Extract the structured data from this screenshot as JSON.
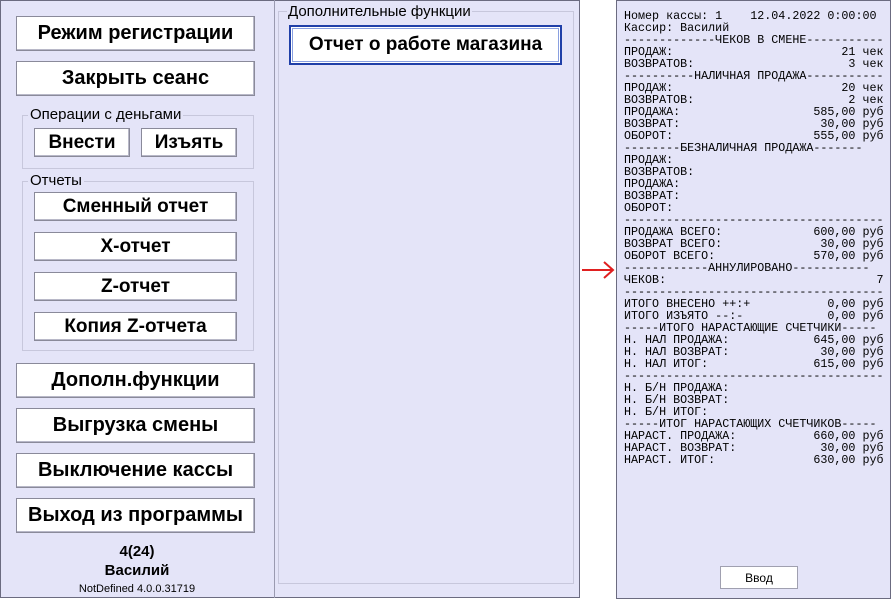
{
  "left_menu": {
    "registration_mode": "Режим регистрации",
    "close_session": "Закрыть сеанс",
    "money_ops_title": "Операции с деньгами",
    "deposit": "Внести",
    "withdraw": "Изъять",
    "reports_title": "Отчеты",
    "shift_report": "Сменный отчет",
    "x_report": "X-отчет",
    "z_report": "Z-отчет",
    "z_copy": "Копия Z-отчета",
    "extra_functions": "Дополн.функции",
    "export_shift": "Выгрузка смены",
    "power_off": "Выключение кассы",
    "exit": "Выход из программы"
  },
  "status": {
    "counter": "4(24)",
    "user": "Василий",
    "version": "NotDefined 4.0.0.31719"
  },
  "extra_panel": {
    "title": "Дополнительные функции",
    "store_report": "Отчет о работе магазина"
  },
  "receipt": {
    "lines": [
      "Номер кассы: 1    12.04.2022 0:00:00",
      "Кассир: Василий",
      "-------------ЧЕКОВ В СМЕНЕ-----------",
      "ПРОДАЖ:                        21 чек",
      "ВОЗВРАТОВ:                      3 чек",
      "----------НАЛИЧНАЯ ПРОДАЖА-----------",
      "ПРОДАЖ:                        20 чек",
      "ВОЗВРАТОВ:                      2 чек",
      "ПРОДАЖА:                   585,00 руб",
      "ВОЗВРАТ:                    30,00 руб",
      "ОБОРОТ:                    555,00 руб",
      "--------БЕЗНАЛИЧНАЯ ПРОДАЖА-------",
      "ПРОДАЖ:",
      "ВОЗВРАТОВ:",
      "ПРОДАЖА:",
      "ВОЗВРАТ:",
      "ОБОРОТ:",
      "-------------------------------------",
      "ПРОДАЖА ВСЕГО:             600,00 руб",
      "ВОЗВРАТ ВСЕГО:              30,00 руб",
      "ОБОРОТ ВСЕГО:              570,00 руб",
      "------------АННУЛИРОВАНО-----------",
      "ЧЕКОВ:                              7",
      "-------------------------------------",
      "ИТОГО ВНЕСЕНО ++:+           0,00 руб",
      "ИТОГО ИЗЪЯТО --:-            0,00 руб",
      "-----ИТОГО НАРАСТАЮЩИЕ СЧЕТЧИКИ-----",
      "Н. НАЛ ПРОДАЖА:            645,00 руб",
      "Н. НАЛ ВОЗВРАТ:             30,00 руб",
      "Н. НАЛ ИТОГ:               615,00 руб",
      "-------------------------------------",
      "Н. Б/Н ПРОДАЖА:",
      "Н. Б/Н ВОЗВРАТ:",
      "Н. Б/Н ИТОГ:",
      "-----ИТОГ НАРАСТАЮЩИХ СЧЕТЧИКОВ-----",
      "НАРАСТ. ПРОДАЖА:           660,00 руб",
      "НАРАСТ. ВОЗВРАТ:            30,00 руб",
      "НАРАСТ. ИТОГ:              630,00 руб"
    ],
    "enter_button": "Ввод"
  },
  "colors": {
    "panel_bg": "#e4e4f8",
    "focus_border": "#1f3fa8",
    "arrow": "#e02020"
  },
  "icons": {
    "arrow": "right-arrow-icon"
  }
}
